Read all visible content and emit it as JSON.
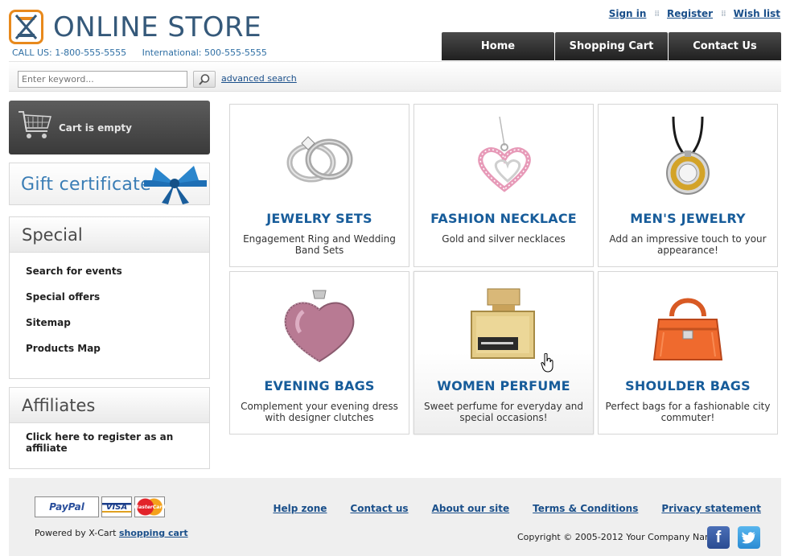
{
  "header": {
    "store_title": "ONLINE STORE",
    "call_us": "CALL US: 1-800-555-5555",
    "international": "International: 500-555-5555",
    "top_links": [
      "Sign in",
      "Register",
      "Wish list"
    ],
    "nav": [
      "Home",
      "Shopping Cart",
      "Contact Us"
    ]
  },
  "search": {
    "placeholder": "Enter keyword...",
    "advanced_label": "advanced search"
  },
  "sidebar": {
    "cart_label": "Cart is empty",
    "gift_label": "Gift certificate",
    "special": {
      "title": "Special",
      "items": [
        "Search for events",
        "Special offers",
        "Sitemap",
        "Products Map"
      ]
    },
    "affiliates": {
      "title": "Affiliates",
      "text": "Click here to register as an affiliate"
    }
  },
  "products": [
    {
      "title": "JEWELRY SETS",
      "desc": "Engagement Ring and Wedding Band Sets",
      "icon": "rings-image"
    },
    {
      "title": "FASHION NECKLACE",
      "desc": "Gold and silver necklaces",
      "icon": "heart-necklace-image"
    },
    {
      "title": "MEN'S JEWELRY",
      "desc": "Add an impressive touch to your appearance!",
      "icon": "pendant-image"
    },
    {
      "title": "EVENING BAGS",
      "desc": "Complement your evening dress with designer clutches",
      "icon": "heart-clutch-image"
    },
    {
      "title": "WOMEN PERFUME",
      "desc": "Sweet perfume for everyday and special occasions!",
      "icon": "perfume-image"
    },
    {
      "title": "SHOULDER BAGS",
      "desc": "Perfect bags for a fashionable city commuter!",
      "icon": "handbag-image"
    }
  ],
  "footer": {
    "payments": [
      "PayPal",
      "VISA",
      "MasterCard"
    ],
    "powered_prefix": "Powered by X-Cart",
    "powered_link": "shopping cart",
    "links": [
      "Help zone",
      "Contact us",
      "About our site",
      "Terms & Conditions",
      "Privacy statement"
    ],
    "copyright": "Copyright © 2005-2012 Your Company Name"
  },
  "colors": {
    "accent_orange": "#e8891c",
    "link_blue": "#1a4f8a",
    "title_blue": "#175c9a",
    "nav_dark": "#2a2a2a"
  }
}
